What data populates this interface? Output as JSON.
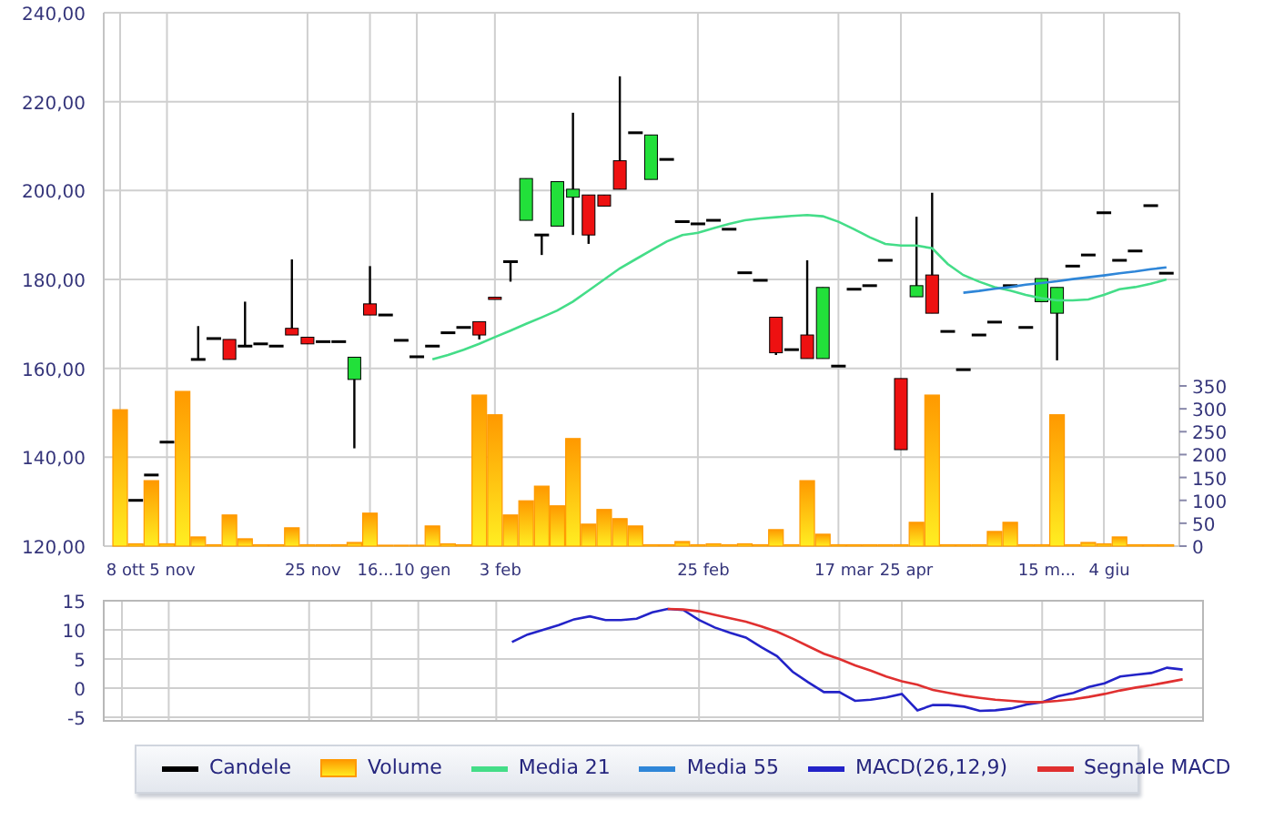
{
  "price_chart": {
    "candle_legend": {
      "label": "Candele",
      "color": "#000000"
    },
    "chart_data": {
      "type": "candlestick",
      "grid": true,
      "categories": [
        "8 ott",
        null,
        null,
        "5 nov",
        null,
        null,
        null,
        null,
        null,
        null,
        null,
        null,
        "25 nov",
        null,
        null,
        null,
        "16...",
        null,
        null,
        "10 gen",
        null,
        null,
        null,
        null,
        "3 feb",
        null,
        null,
        null,
        null,
        null,
        null,
        null,
        null,
        null,
        null,
        null,
        null,
        "25 feb",
        null,
        null,
        null,
        null,
        null,
        null,
        null,
        null,
        "17 mar",
        null,
        null,
        null,
        "25 apr",
        null,
        null,
        null,
        null,
        null,
        null,
        null,
        null,
        "15 m...",
        null,
        null,
        null,
        "4 giu",
        null,
        null,
        null,
        null,
        null
      ],
      "ylim": [
        120,
        240
      ],
      "yticks": [
        {
          "value": 120,
          "label": "120,00"
        },
        {
          "value": 140,
          "label": "140,00"
        },
        {
          "value": 160,
          "label": "160,00"
        },
        {
          "value": 180,
          "label": "180,00"
        },
        {
          "value": 200,
          "label": "200,00"
        },
        {
          "value": 220,
          "label": "220,00"
        },
        {
          "value": 240,
          "label": "240,00"
        }
      ],
      "ohlc": [
        null,
        [
          130.3,
          130.3,
          130.3,
          130.3
        ],
        [
          136,
          136,
          136,
          136
        ],
        [
          143.4,
          143.4,
          143.4,
          143.4
        ],
        null,
        [
          162,
          169.5,
          162,
          162
        ],
        [
          166.7,
          166.7,
          166.7,
          166.7
        ],
        [
          166.5,
          166.5,
          162,
          162
        ],
        [
          165,
          175,
          165,
          165
        ],
        [
          165.5,
          165.5,
          165.5,
          165.5
        ],
        [
          165,
          165,
          165,
          165
        ],
        [
          169,
          184.5,
          167.5,
          167.5
        ],
        [
          167,
          167,
          165.5,
          165.5
        ],
        [
          166,
          166,
          166,
          166
        ],
        [
          166,
          166,
          166,
          166
        ],
        [
          157.5,
          162.5,
          142,
          162.5
        ],
        [
          174.5,
          183,
          172,
          172
        ],
        [
          172,
          172,
          172,
          172
        ],
        [
          166.3,
          166.3,
          166.3,
          166.3
        ],
        [
          162.6,
          162.6,
          162.6,
          162.6
        ],
        [
          165,
          165,
          165,
          165
        ],
        [
          168,
          168,
          168,
          168
        ],
        [
          169.2,
          169.2,
          169.2,
          169.2
        ],
        [
          170.5,
          170.5,
          166.5,
          167.5
        ],
        [
          176,
          176,
          175.5,
          175.5
        ],
        [
          184,
          184,
          179.5,
          184
        ],
        [
          193.3,
          202.7,
          193.3,
          202.7
        ],
        [
          190,
          190,
          185.5,
          190
        ],
        [
          192,
          202,
          192,
          202
        ],
        [
          198.5,
          217.5,
          190,
          200.3
        ],
        [
          199,
          199,
          188,
          190
        ],
        [
          199,
          199,
          196.5,
          196.5
        ],
        [
          206.7,
          225.7,
          200.3,
          200.3
        ],
        [
          213,
          213,
          213,
          213
        ],
        [
          202.5,
          212.5,
          202.5,
          212.5
        ],
        [
          207,
          207,
          207,
          207
        ],
        [
          193,
          193,
          193,
          193
        ],
        [
          192.5,
          192.5,
          192.5,
          192.5
        ],
        [
          193.3,
          193.3,
          193.3,
          193.3
        ],
        [
          191.3,
          191.3,
          191.3,
          191.3
        ],
        [
          181.5,
          181.5,
          181.5,
          181.5
        ],
        [
          179.8,
          179.8,
          179.8,
          179.8
        ],
        [
          171.5,
          171.5,
          163,
          163.5
        ],
        [
          164.2,
          164.2,
          164.2,
          164.2
        ],
        [
          167.5,
          184.3,
          162.2,
          162.2
        ],
        [
          162.2,
          178.2,
          162.2,
          178.2
        ],
        [
          160.5,
          160.5,
          160.5,
          160.5
        ],
        [
          177.8,
          177.8,
          177.8,
          177.8
        ],
        [
          178.6,
          178.6,
          178.6,
          178.6
        ],
        [
          184.3,
          184.3,
          184.3,
          184.3
        ],
        [
          157.7,
          157.7,
          141.7,
          141.7
        ],
        [
          176.1,
          194.1,
          176.1,
          178.6
        ],
        [
          181,
          199.5,
          172.4,
          172.4
        ],
        [
          168.3,
          168.3,
          168.3,
          168.3
        ],
        [
          159.7,
          159.7,
          159.7,
          159.7
        ],
        [
          167.5,
          167.5,
          167.5,
          167.5
        ],
        [
          170.4,
          170.4,
          170.4,
          170.4
        ],
        [
          178.6,
          178.6,
          178.6,
          178.6
        ],
        [
          169.2,
          169.2,
          169.2,
          169.2
        ],
        [
          175,
          180.2,
          175,
          180.2
        ],
        [
          172.4,
          178.2,
          161.8,
          178.2
        ],
        [
          183,
          183,
          183,
          183
        ],
        [
          185.5,
          185.5,
          185.5,
          185.5
        ],
        [
          195,
          195,
          195,
          195
        ],
        [
          184.3,
          184.3,
          184.3,
          184.3
        ],
        [
          186.4,
          186.4,
          186.4,
          186.4
        ],
        [
          196.6,
          196.6,
          196.6,
          196.6
        ],
        [
          181.4,
          181.4,
          181.4,
          181.4
        ],
        null
      ]
    }
  },
  "moving_averages": {
    "chart_data": {
      "type": "line",
      "categories": [
        null,
        null,
        null,
        null,
        null,
        null,
        null,
        null,
        null,
        null,
        null,
        null,
        null,
        null,
        null,
        null,
        null,
        null,
        null,
        null,
        null,
        null,
        null,
        null,
        null,
        null,
        null,
        null,
        null,
        null,
        null,
        null,
        null,
        null,
        null,
        null,
        null,
        null,
        null,
        null,
        null,
        null,
        null,
        null,
        null,
        null,
        null,
        null,
        null,
        null,
        null,
        null,
        null,
        null,
        null,
        null,
        null,
        null,
        null,
        null,
        null,
        null,
        null,
        null,
        null,
        null,
        null,
        null,
        null
      ],
      "ylim": [
        120,
        240
      ],
      "series": [
        {
          "name": "Media 21",
          "color": "#44dd88",
          "values": [
            null,
            null,
            null,
            null,
            null,
            null,
            null,
            null,
            null,
            null,
            null,
            null,
            null,
            null,
            null,
            null,
            null,
            null,
            null,
            null,
            162,
            163,
            164.2,
            165.5,
            167,
            168.5,
            170,
            171.5,
            173,
            175,
            177.5,
            180,
            182.5,
            184.5,
            186.5,
            188.5,
            190,
            190.5,
            191.5,
            192.5,
            193.3,
            193.7,
            194,
            194.3,
            194.5,
            194.2,
            193,
            191.3,
            189.5,
            188,
            187.6,
            187.6,
            187,
            183.5,
            181,
            179.5,
            178.3,
            177.5,
            176.5,
            175.8,
            175.3,
            175.3,
            175.5,
            176.5,
            177.8,
            178.3,
            179,
            180,
            null
          ]
        },
        {
          "name": "Media 55",
          "color": "#2f86d8",
          "values": [
            null,
            null,
            null,
            null,
            null,
            null,
            null,
            null,
            null,
            null,
            null,
            null,
            null,
            null,
            null,
            null,
            null,
            null,
            null,
            null,
            null,
            null,
            null,
            null,
            null,
            null,
            null,
            null,
            null,
            null,
            null,
            null,
            null,
            null,
            null,
            null,
            null,
            null,
            null,
            null,
            null,
            null,
            null,
            null,
            null,
            null,
            null,
            null,
            null,
            null,
            null,
            null,
            null,
            null,
            177,
            177.4,
            177.9,
            178.3,
            178.8,
            179.2,
            179.6,
            180.1,
            180.5,
            180.9,
            181.4,
            181.8,
            182.3,
            182.7,
            null
          ]
        }
      ]
    }
  },
  "volume_chart": {
    "chart_data": {
      "type": "bar",
      "grid": true,
      "categories": [
        null,
        null,
        null,
        null,
        null,
        null,
        null,
        null,
        null,
        null,
        null,
        null,
        null,
        null,
        null,
        null,
        null,
        null,
        null,
        null,
        null,
        null,
        null,
        null,
        null,
        null,
        null,
        null,
        null,
        null,
        null,
        null,
        null,
        null,
        null,
        null,
        null,
        null,
        null,
        null,
        null,
        null,
        null,
        null,
        null,
        null,
        null,
        null,
        null,
        null,
        null,
        null,
        null,
        null,
        null,
        null,
        null,
        null,
        null,
        null,
        null,
        null,
        null,
        null,
        null,
        null,
        null,
        null,
        null
      ],
      "ylim": [
        0,
        350
      ],
      "yticks": [
        0,
        50,
        100,
        150,
        200,
        250,
        300,
        350
      ],
      "series": [
        {
          "name": "Volume",
          "color": "#ff9900",
          "values": [
            298,
            5,
            143,
            5,
            338,
            20,
            3,
            68,
            16,
            3,
            3,
            40,
            3,
            3,
            3,
            8,
            72,
            2,
            2,
            2,
            44,
            5,
            3,
            330,
            287,
            68,
            99,
            131,
            88,
            235,
            48,
            80,
            60,
            44,
            3,
            3,
            10,
            3,
            5,
            3,
            5,
            3,
            36,
            3,
            143,
            26,
            3,
            3,
            3,
            3,
            3,
            52,
            330,
            3,
            3,
            3,
            32,
            52,
            3,
            3,
            287,
            3,
            8,
            5,
            20,
            3,
            3,
            3,
            null
          ]
        }
      ]
    }
  },
  "macd_chart": {
    "chart_data": {
      "type": "line",
      "grid": true,
      "categories": [
        null,
        null,
        null,
        null,
        null,
        null,
        null,
        null,
        null,
        null,
        null,
        null,
        null,
        null,
        null,
        null,
        null,
        null,
        null,
        null,
        null,
        null,
        null,
        null,
        null,
        null,
        null,
        null,
        null,
        null,
        null,
        null,
        null,
        null,
        null,
        null,
        null,
        null,
        null,
        null,
        null,
        null,
        null,
        null,
        null,
        null,
        null,
        null,
        null,
        null,
        null,
        null,
        null,
        null,
        null,
        null,
        null,
        null,
        null,
        null,
        null,
        null,
        null,
        null,
        null,
        null,
        null,
        null,
        null
      ],
      "ylim": [
        -5,
        15
      ],
      "yticks": [
        -5,
        0,
        5,
        10,
        15
      ],
      "series": [
        {
          "name": "MACD(26,12,9)",
          "color": "#2323c8",
          "values": [
            null,
            null,
            null,
            null,
            null,
            null,
            null,
            null,
            null,
            null,
            null,
            null,
            null,
            null,
            null,
            null,
            null,
            null,
            null,
            null,
            null,
            null,
            null,
            null,
            null,
            7.9,
            9.2,
            10,
            10.8,
            11.8,
            12.3,
            11.7,
            11.7,
            11.9,
            13,
            13.6,
            13.4,
            11.7,
            10.4,
            9.5,
            8.7,
            7,
            5.5,
            2.8,
            1,
            -0.7,
            -0.7,
            -2.2,
            -2,
            -1.6,
            -1,
            -3.8,
            -2.9,
            -2.9,
            -3.2,
            -3.9,
            -3.8,
            -3.5,
            -2.8,
            -2.4,
            -1.4,
            -0.8,
            0.2,
            0.8,
            2,
            2.3,
            2.6,
            3.5,
            3.2
          ]
        },
        {
          "name": "Segnale MACD",
          "color": "#e03030",
          "values": [
            null,
            null,
            null,
            null,
            null,
            null,
            null,
            null,
            null,
            null,
            null,
            null,
            null,
            null,
            null,
            null,
            null,
            null,
            null,
            null,
            null,
            null,
            null,
            null,
            null,
            null,
            null,
            null,
            null,
            null,
            null,
            null,
            null,
            null,
            null,
            13.6,
            13.5,
            13.2,
            12.6,
            12,
            11.4,
            10.6,
            9.7,
            8.5,
            7.2,
            5.9,
            5,
            3.9,
            3,
            2,
            1.2,
            0.6,
            -0.3,
            -0.8,
            -1.3,
            -1.7,
            -2,
            -2.2,
            -2.4,
            -2.4,
            -2.2,
            -1.9,
            -1.5,
            -1,
            -0.4,
            0.1,
            0.5,
            1,
            1.5
          ]
        }
      ]
    }
  }
}
